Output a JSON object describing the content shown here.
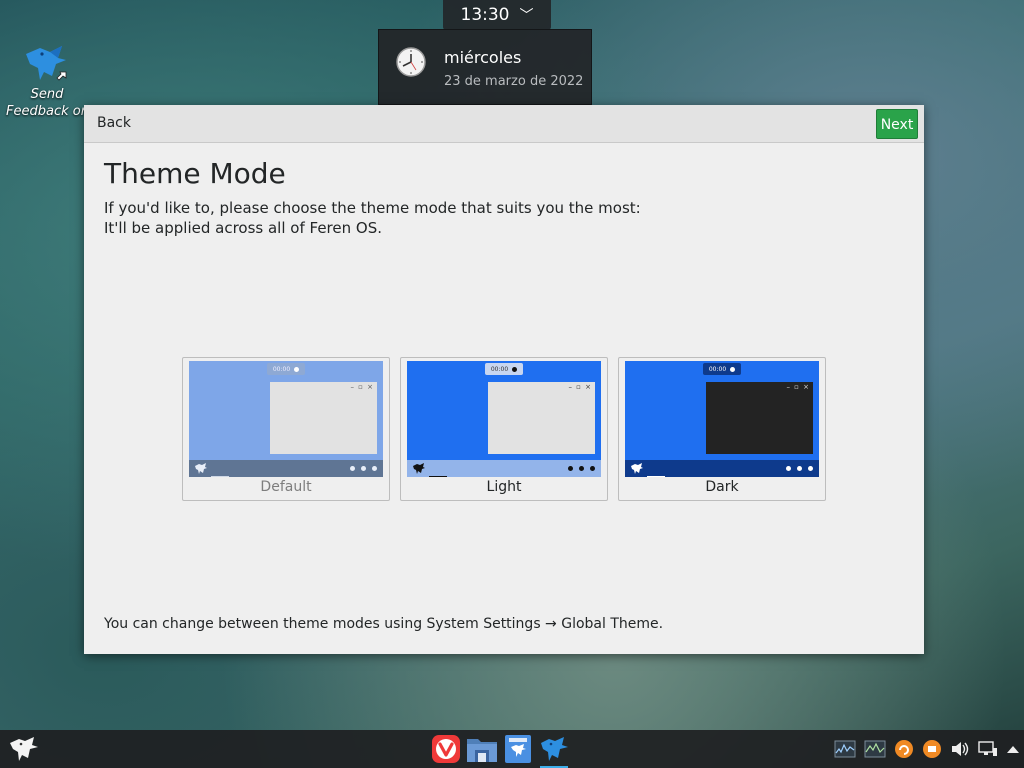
{
  "desktop": {
    "icon_label_line1": "Send",
    "icon_label_line2": "Feedback on",
    "icon": "feren-bird-icon"
  },
  "clock": {
    "time": "13:30",
    "chevron": "﹀"
  },
  "date_popup": {
    "day": "miércoles",
    "date": "23 de marzo de 2022"
  },
  "dialog": {
    "back_label": "Back",
    "next_label": "Next",
    "title": "Theme Mode",
    "description_line1": "If you'd like to, please choose the theme mode that suits you the most:",
    "description_line2": "It'll be applied across all of Feren OS.",
    "footer": "You can change between theme modes using System Settings → Global Theme.",
    "accent_next": "#2aa34a"
  },
  "themes": [
    {
      "name": "Default",
      "preview_time": "00:00",
      "win_controls": "– ▫ ×",
      "bg": "#7ea6e8",
      "window": "#e2e2e2",
      "bar": "#5f7594",
      "state": "disabled"
    },
    {
      "name": "Light",
      "preview_time": "00:00",
      "win_controls": "– ▫ ×",
      "bg": "#1f6ff0",
      "window": "#e2e2e2",
      "bar": "#93b4ea",
      "state": "normal"
    },
    {
      "name": "Dark",
      "preview_time": "00:00",
      "win_controls": "– ▫ ×",
      "bg": "#1f6ff0",
      "window": "#232323",
      "bar": "#0e3a8c",
      "state": "normal"
    }
  ],
  "taskbar": {
    "start_icon": "feren-start-icon",
    "apps": [
      "vivaldi-icon",
      "file-manager-icon",
      "feren-store-icon",
      "feren-welcome-icon"
    ],
    "tray": [
      "system-monitor-icon",
      "network-monitor-icon",
      "update-notifier-icon",
      "printer-icon",
      "volume-icon",
      "network-icon",
      "tray-expand-icon"
    ]
  }
}
